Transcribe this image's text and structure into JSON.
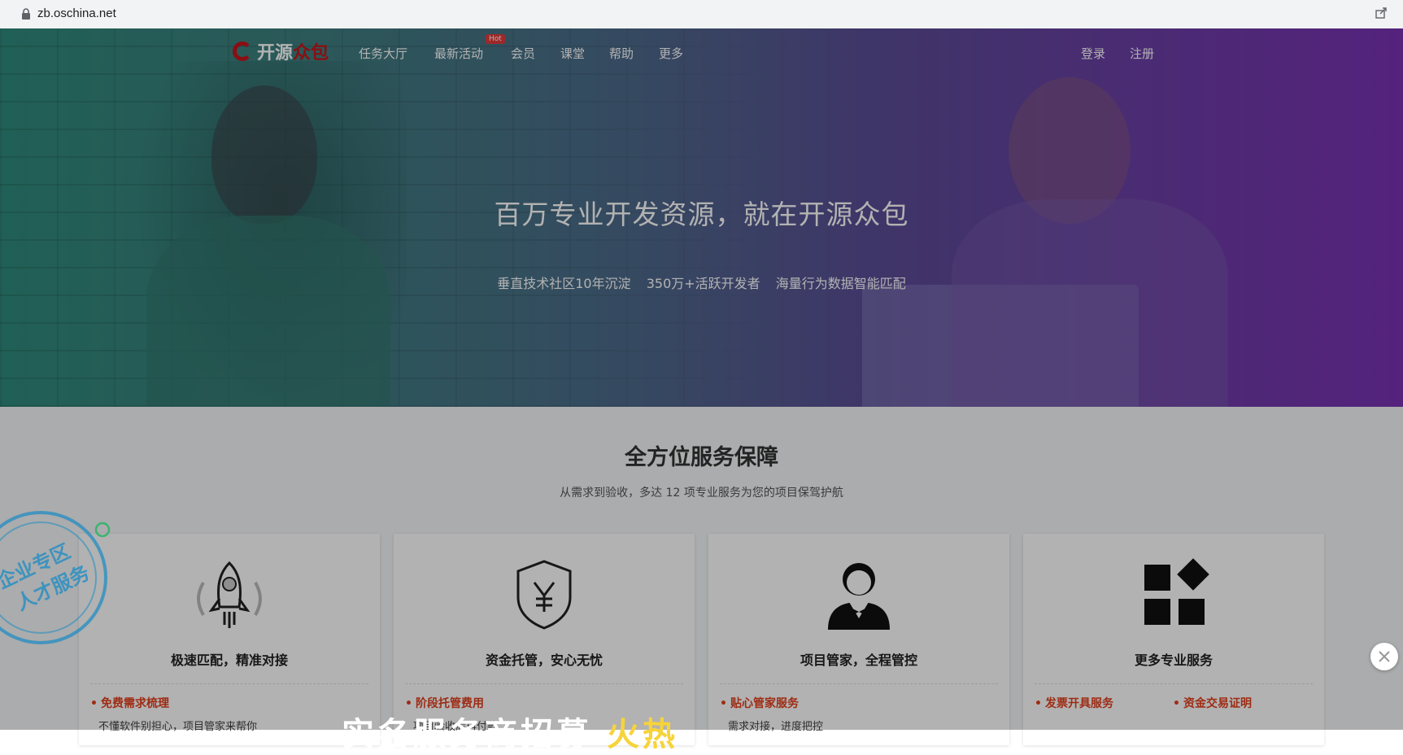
{
  "browser": {
    "url": "zb.oschina.net"
  },
  "nav": {
    "logo_main": "开源",
    "logo_accent": "众包",
    "items": [
      "任务大厅",
      "最新活动",
      "会员",
      "课堂",
      "帮助",
      "更多"
    ],
    "hot_badge": "Hot",
    "login": "登录",
    "register": "注册"
  },
  "hero": {
    "title": "百万专业开发资源，就在开源众包",
    "subtitles": [
      "垂直技术社区10年沉淀",
      "350万+活跃开发者",
      "海量行为数据智能匹配"
    ]
  },
  "services": {
    "title": "全方位服务保障",
    "subtitle": "从需求到验收，多达 12 项专业服务为您的项目保驾护航",
    "cards": [
      {
        "icon": "rocket-icon",
        "title": "极速匹配，精准对接",
        "features": [
          "免费需求梳理"
        ],
        "desc": "不懂软件别担心，项目管家来帮你"
      },
      {
        "icon": "shield-yen-icon",
        "title": "资金托管，安心无忧",
        "features": [
          "阶段托管费用"
        ],
        "desc": "项目验收后再付款"
      },
      {
        "icon": "butler-icon",
        "title": "项目管家，全程管控",
        "features": [
          "贴心管家服务"
        ],
        "desc": "需求对接，进度把控"
      },
      {
        "icon": "apps-icon",
        "title": "更多专业服务",
        "features": [
          "发票开具服务",
          "资金交易证明"
        ],
        "desc": ""
      }
    ]
  },
  "stamp": {
    "line1": "企业专区",
    "line2": "人才服务"
  },
  "modal_banner": {
    "text_white": "实名服务商招募",
    "text_yellow": "火热"
  },
  "colors": {
    "brand_red": "#c4161c",
    "feature_orange": "#e2401e",
    "hot_red": "#e23b3b",
    "stamp_blue": "#2b8fc2"
  }
}
